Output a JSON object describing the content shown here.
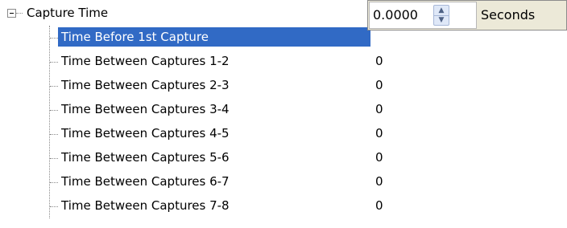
{
  "tree": {
    "root": {
      "label": "Capture Time",
      "expander_icon": "minus-box-icon"
    },
    "items": [
      {
        "label": "Time Before 1st Capture",
        "value": "0.0000",
        "selected": true
      },
      {
        "label": "Time Between Captures 1-2",
        "value": "0"
      },
      {
        "label": "Time Between Captures 2-3",
        "value": "0"
      },
      {
        "label": "Time Between Captures 3-4",
        "value": "0"
      },
      {
        "label": "Time Between Captures 4-5",
        "value": "0"
      },
      {
        "label": "Time Between Captures 5-6",
        "value": "0"
      },
      {
        "label": "Time Between Captures 6-7",
        "value": "0"
      },
      {
        "label": "Time Between Captures 7-8",
        "value": "0"
      }
    ]
  },
  "editor": {
    "value": "0.0000",
    "unit": "Seconds",
    "spin_up_icon": "chevron-up-icon",
    "spin_down_icon": "chevron-down-icon"
  },
  "colors": {
    "selection_bg": "#316ac5",
    "selection_text": "#ffffff",
    "editor_bg": "#ece9d8"
  }
}
